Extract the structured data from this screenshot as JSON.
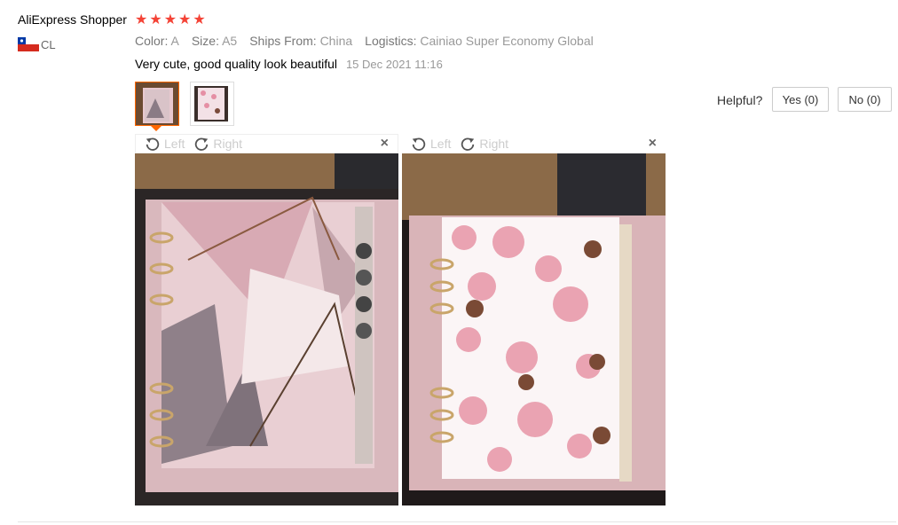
{
  "reviewer": {
    "name": "AliExpress Shopper",
    "stars": 5,
    "country": "CL",
    "flag_icon": "chile-flag-icon"
  },
  "attributes": [
    {
      "key": "Color:",
      "value": "A"
    },
    {
      "key": "Size:",
      "value": "A5"
    },
    {
      "key": "Ships From:",
      "value": "China"
    },
    {
      "key": "Logistics:",
      "value": "Cainiao Super Economy Global"
    }
  ],
  "review": {
    "text": "Very cute, good quality look beautiful",
    "date": "15 Dec 2021 11:16"
  },
  "helpful": {
    "label": "Helpful?",
    "yes": "Yes (0)",
    "no": "No (0)"
  },
  "viewer": {
    "left_label": "Left",
    "right_label": "Right",
    "close_glyph": "×"
  },
  "colors": {
    "star": "#f44336",
    "accent": "#ff6600"
  }
}
